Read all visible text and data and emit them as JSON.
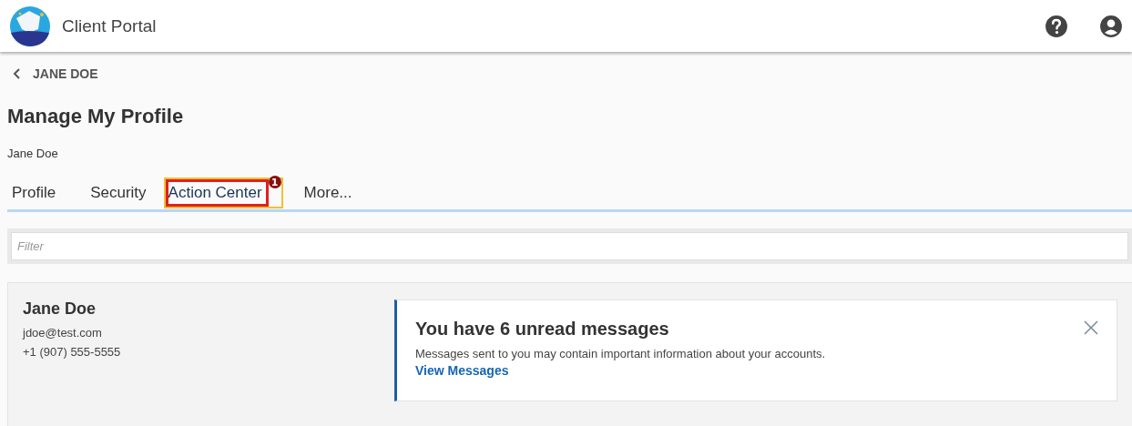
{
  "header": {
    "title": "Client Portal"
  },
  "breadcrumb": {
    "label": "JANE DOE"
  },
  "page": {
    "title": "Manage My Profile",
    "subtitle": "Jane Doe"
  },
  "tabs": [
    {
      "label": "Profile",
      "selected": false
    },
    {
      "label": "Security",
      "selected": false
    },
    {
      "label": "Action Center",
      "selected": true,
      "badge": "1"
    },
    {
      "label": "More...",
      "selected": false
    }
  ],
  "filter": {
    "placeholder": "Filter"
  },
  "contact": {
    "name": "Jane Doe",
    "email": "jdoe@test.com",
    "phone": "+1 (907) 555-5555"
  },
  "notification": {
    "title": "You have 6 unread messages",
    "message": "Messages sent to you may contain important information about your accounts.",
    "link": "View Messages"
  }
}
